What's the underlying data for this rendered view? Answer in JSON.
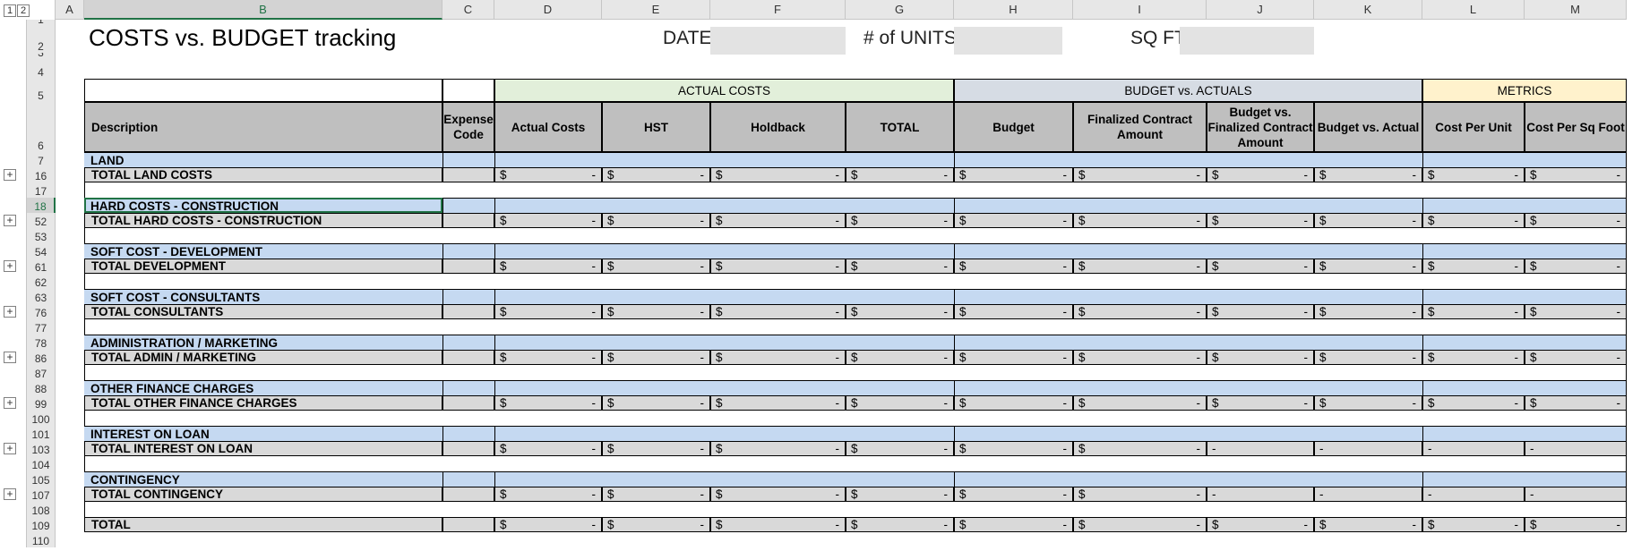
{
  "columns": [
    "A",
    "B",
    "C",
    "D",
    "E",
    "F",
    "G",
    "H",
    "I",
    "J",
    "K",
    "L",
    "M"
  ],
  "selected_column": "B",
  "outline_levels": [
    "1",
    "2"
  ],
  "title": "COSTS vs. BUDGET tracking",
  "fields": {
    "date_label": "DATE",
    "date_value": "",
    "units_label": "# of UNITS",
    "units_value": "",
    "sqft_label": "SQ FT",
    "sqft_value": ""
  },
  "groups": {
    "actual": "ACTUAL COSTS",
    "budget": "BUDGET vs. ACTUALS",
    "metrics": "METRICS"
  },
  "headers": {
    "description": "Description",
    "expense_code": "Expense Code",
    "actual_costs": "Actual Costs",
    "hst": "HST",
    "holdback": "Holdback",
    "total": "TOTAL",
    "budget": "Budget",
    "finalized_contract": "Finalized Contract Amount",
    "budget_vs_finalized": "Budget vs. Finalized Contract Amount",
    "budget_vs_actual": "Budget vs. Actual",
    "cost_per_unit": "Cost Per Unit",
    "cost_per_sqft": "Cost Per Sq Foot"
  },
  "money": {
    "symbol": "$",
    "dash": "-"
  },
  "rows": [
    {
      "num": "1",
      "type": "spacer"
    },
    {
      "num": "2",
      "type": "title"
    },
    {
      "num": "3",
      "type": "spacer"
    },
    {
      "num": "4",
      "type": "spacer"
    },
    {
      "num": "5",
      "type": "group"
    },
    {
      "num": "6",
      "type": "colhdr"
    },
    {
      "num": "7",
      "type": "section",
      "label": "LAND"
    },
    {
      "num": "16",
      "type": "total",
      "label": "TOTAL LAND COSTS",
      "collapsed": true
    },
    {
      "num": "17",
      "type": "blank"
    },
    {
      "num": "18",
      "type": "section",
      "label": "HARD COSTS - CONSTRUCTION",
      "selected": true
    },
    {
      "num": "52",
      "type": "total",
      "label": "TOTAL HARD COSTS - CONSTRUCTION",
      "collapsed": true
    },
    {
      "num": "53",
      "type": "blank"
    },
    {
      "num": "54",
      "type": "section",
      "label": "SOFT COST - DEVELOPMENT"
    },
    {
      "num": "61",
      "type": "total",
      "label": "TOTAL DEVELOPMENT",
      "collapsed": true
    },
    {
      "num": "62",
      "type": "blank"
    },
    {
      "num": "63",
      "type": "section",
      "label": "SOFT COST - CONSULTANTS"
    },
    {
      "num": "76",
      "type": "total",
      "label": "TOTAL CONSULTANTS",
      "collapsed": true
    },
    {
      "num": "77",
      "type": "blank"
    },
    {
      "num": "78",
      "type": "section",
      "label": "ADMINISTRATION / MARKETING"
    },
    {
      "num": "86",
      "type": "total",
      "label": "TOTAL ADMIN / MARKETING",
      "collapsed": true
    },
    {
      "num": "87",
      "type": "blank"
    },
    {
      "num": "88",
      "type": "section",
      "label": "OTHER FINANCE CHARGES"
    },
    {
      "num": "99",
      "type": "total",
      "label": "TOTAL OTHER FINANCE CHARGES",
      "collapsed": true
    },
    {
      "num": "100",
      "type": "blank"
    },
    {
      "num": "101",
      "type": "section",
      "label": "INTEREST ON LOAN"
    },
    {
      "num": "103",
      "type": "total",
      "label": "TOTAL INTEREST ON LOAN",
      "collapsed": true,
      "dash_only": true
    },
    {
      "num": "104",
      "type": "blank"
    },
    {
      "num": "105",
      "type": "section",
      "label": "CONTINGENCY"
    },
    {
      "num": "107",
      "type": "total",
      "label": "TOTAL CONTINGENCY",
      "collapsed": true,
      "dash_only": true
    },
    {
      "num": "108",
      "type": "blank"
    },
    {
      "num": "109",
      "type": "total",
      "label": "TOTAL"
    },
    {
      "num": "110",
      "type": "spacer"
    }
  ],
  "colors": {
    "section": "#c5d9f1",
    "total_row": "#d9d9d9",
    "header_gray": "#bfbfbf",
    "actual_group": "#e2efda",
    "budget_group": "#d6dce4",
    "metrics_group": "#fff2cc",
    "selection": "#217346"
  }
}
